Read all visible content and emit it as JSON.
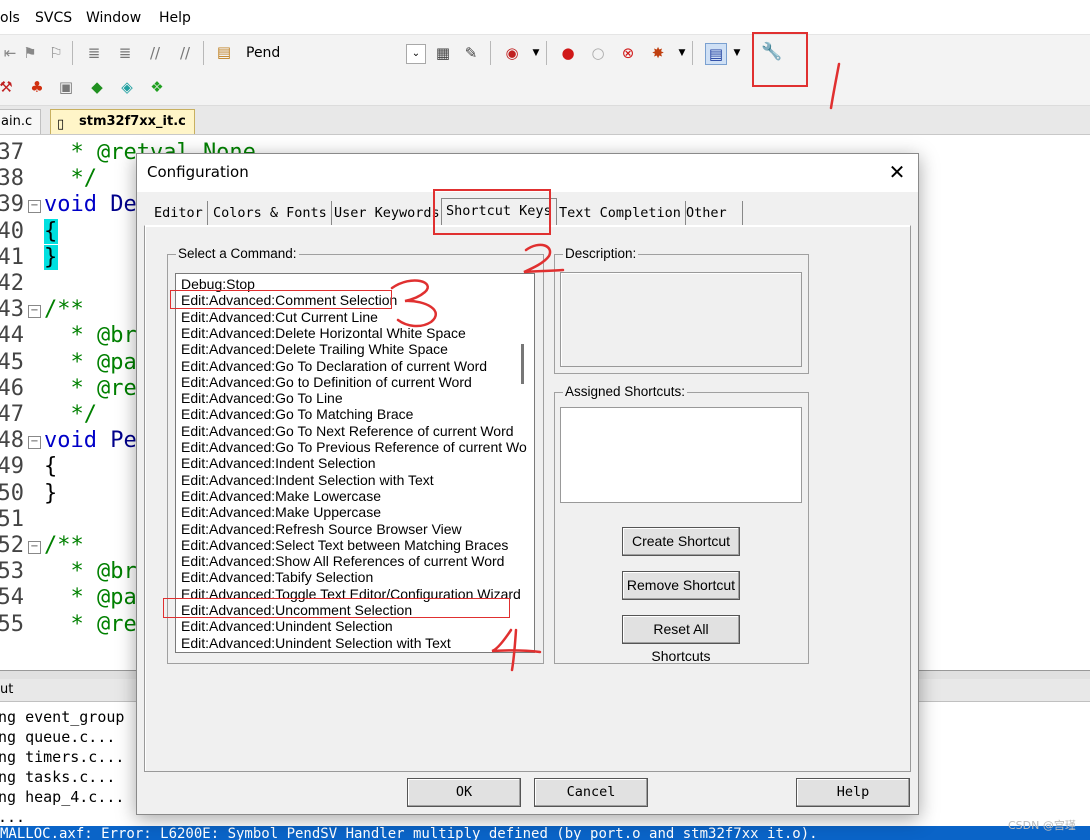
{
  "menu": [
    "ols",
    "SVCS",
    "Window",
    "Help"
  ],
  "toolbar": {
    "pend_label": "Pend"
  },
  "file_tabs": [
    "ain.c",
    "stm32f7xx_it.c"
  ],
  "editor": {
    "lines": [
      {
        "n": "37",
        "text": "  * @retval None"
      },
      {
        "n": "38",
        "text": "  */"
      },
      {
        "n": "39",
        "text": "void De"
      },
      {
        "n": "40",
        "text": "{"
      },
      {
        "n": "41",
        "text": "}"
      },
      {
        "n": "42",
        "text": ""
      },
      {
        "n": "43",
        "text": "/**"
      },
      {
        "n": "44",
        "text": "  * @br"
      },
      {
        "n": "45",
        "text": "  * @pa"
      },
      {
        "n": "46",
        "text": "  * @re"
      },
      {
        "n": "47",
        "text": "  */"
      },
      {
        "n": "48",
        "text": "void Pe"
      },
      {
        "n": "49",
        "text": "{"
      },
      {
        "n": "50",
        "text": "}"
      },
      {
        "n": "51",
        "text": ""
      },
      {
        "n": "52",
        "text": "/**"
      },
      {
        "n": "53",
        "text": "  * @br"
      },
      {
        "n": "54",
        "text": "  * @pa"
      },
      {
        "n": "55",
        "text": "  * @re"
      }
    ]
  },
  "output": {
    "header": "ut",
    "lines": [
      "ng event_group",
      "ng queue.c...",
      "ng timers.c...",
      "ng tasks.c...",
      "ng heap_4.c...",
      "..."
    ],
    "status": "MALLOC.axf: Error: L6200E: Symbol PendSV_Handler multiply defined (by port.o and stm32f7xx_it.o)."
  },
  "dialog": {
    "title": "Configuration",
    "tabs": [
      "Editor",
      "Colors & Fonts",
      "User Keywords",
      "Shortcut Keys",
      "Text Completion",
      "Other"
    ],
    "active_tab": "Shortcut Keys",
    "select_command_label": "Select a Command:",
    "description_label": "Description:",
    "assigned_shortcuts_label": "Assigned Shortcuts:",
    "commands": [
      "Debug:Stop",
      "Edit:Advanced:Comment Selection",
      "Edit:Advanced:Cut Current Line",
      "Edit:Advanced:Delete Horizontal White Space",
      "Edit:Advanced:Delete Trailing White Space",
      "Edit:Advanced:Go To Declaration of current Word",
      "Edit:Advanced:Go to Definition of current Word",
      "Edit:Advanced:Go To Line",
      "Edit:Advanced:Go To Matching Brace",
      "Edit:Advanced:Go To Next Reference of current Word",
      "Edit:Advanced:Go To Previous Reference of current Wo",
      "Edit:Advanced:Indent Selection",
      "Edit:Advanced:Indent Selection with Text",
      "Edit:Advanced:Make Lowercase",
      "Edit:Advanced:Make Uppercase",
      "Edit:Advanced:Refresh Source Browser View",
      "Edit:Advanced:Select Text between Matching Braces",
      "Edit:Advanced:Show All References of current Word",
      "Edit:Advanced:Tabify Selection",
      "Edit:Advanced:Toggle Text Editor/Configuration Wizard",
      "Edit:Advanced:Uncomment Selection",
      "Edit:Advanced:Unindent Selection",
      "Edit:Advanced:Unindent Selection with Text"
    ],
    "buttons": {
      "create_shortcut": "Create Shortcut",
      "remove_shortcut": "Remove Shortcut",
      "reset_all_shortcuts": "Reset All Shortcuts",
      "ok": "OK",
      "cancel": "Cancel",
      "help": "Help"
    }
  },
  "annotations": {
    "n1": "1",
    "n2": "2",
    "n3": "3",
    "n4": "4",
    "color": "#e03030"
  },
  "watermark": "CSDN @宫瑾"
}
